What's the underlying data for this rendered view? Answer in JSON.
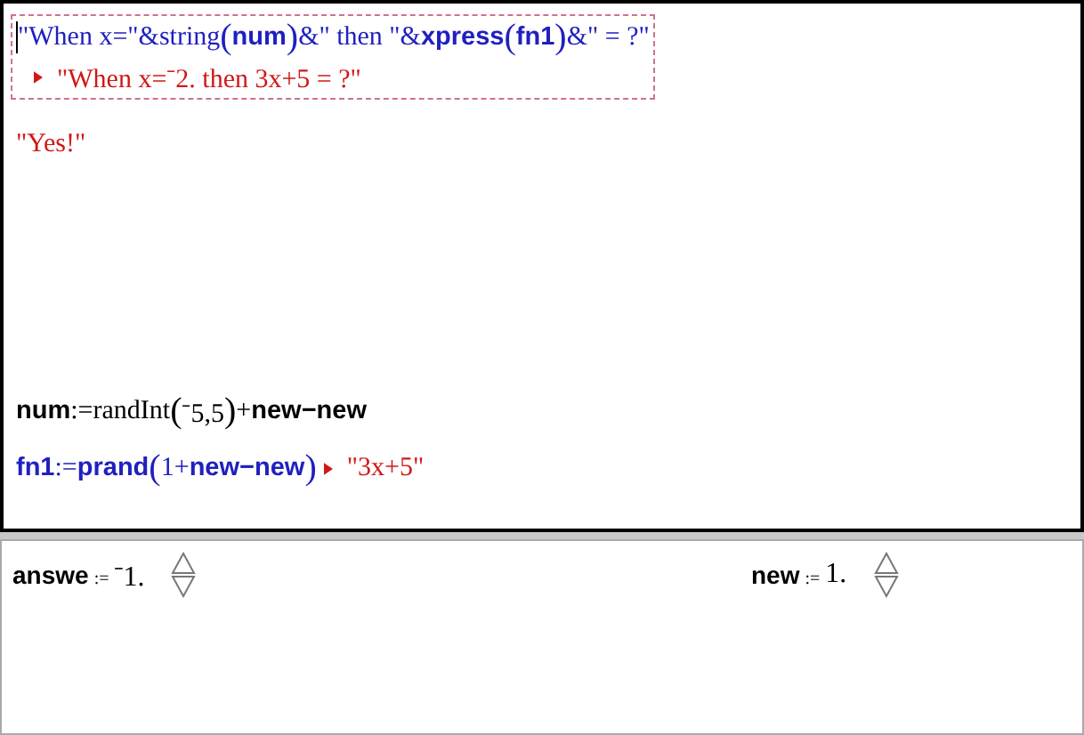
{
  "scratchpad": {
    "top_entries": [
      {
        "kind": "result_below",
        "color": "#2020c0",
        "selected": true,
        "segments": [
          {
            "kind": "serif",
            "t": "\"When x=\"&string"
          },
          {
            "kind": "paren",
            "t": "("
          },
          {
            "kind": "bold",
            "t": "num"
          },
          {
            "kind": "paren",
            "t": ")"
          },
          {
            "kind": "serif",
            "t": "&\" then \"&"
          },
          {
            "kind": "bold",
            "t": "xpress"
          },
          {
            "kind": "paren",
            "t": "("
          },
          {
            "kind": "bold",
            "t": "fn1"
          },
          {
            "kind": "paren",
            "t": ")"
          },
          {
            "kind": "serif",
            "t": "&\" = ?\""
          }
        ],
        "result": "\"When x=⁻2. then 3x+5 = ?\""
      },
      {
        "kind": "plain",
        "color": "#d01818",
        "selected": false,
        "segments": [
          {
            "kind": "serif",
            "t": "\"Yes!\""
          }
        ]
      }
    ],
    "bottom_entries": [
      {
        "kind": "plain",
        "color": "#000000",
        "selected": false,
        "segments": [
          {
            "kind": "bold",
            "t": "num"
          },
          {
            "kind": "serif",
            "t": ":=randInt"
          },
          {
            "kind": "paren",
            "t": "("
          },
          {
            "kind": "serif",
            "t": "⁻5,5"
          },
          {
            "kind": "paren",
            "t": ")"
          },
          {
            "kind": "serif",
            "t": "+"
          },
          {
            "kind": "bold",
            "t": "new−new"
          }
        ]
      },
      {
        "kind": "result_inline",
        "color": "#2020c0",
        "selected": false,
        "segments": [
          {
            "kind": "bold",
            "t": "fn1"
          },
          {
            "kind": "serif",
            "t": ":="
          },
          {
            "kind": "bold",
            "t": "prand"
          },
          {
            "kind": "paren",
            "t": "("
          },
          {
            "kind": "serif",
            "t": "1+"
          },
          {
            "kind": "bold",
            "t": "new−new"
          },
          {
            "kind": "paren",
            "t": ")"
          }
        ],
        "result": "\"3x+5\""
      }
    ]
  },
  "sliders": [
    {
      "name": "answe",
      "assign": ":=",
      "value": "⁻1."
    },
    {
      "name": "new",
      "assign": ":=",
      "value": "1."
    }
  ]
}
